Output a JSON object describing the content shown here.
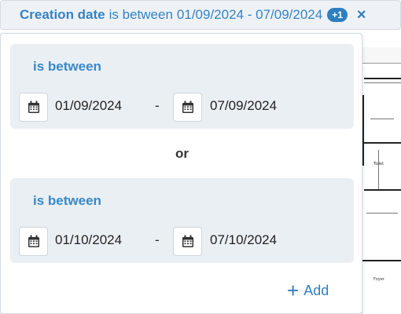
{
  "chip": {
    "field": "Creation date",
    "operator": "is between",
    "range": "01/09/2024 - 07/09/2024",
    "extra_count": "+1",
    "close_icon": "×"
  },
  "groups": [
    {
      "operator_label": "is between",
      "start_date": "01/09/2024",
      "separator": "-",
      "end_date": "07/09/2024"
    },
    {
      "operator_label": "is between",
      "start_date": "01/10/2024",
      "separator": "-",
      "end_date": "07/10/2024"
    }
  ],
  "or_label": "or",
  "add": {
    "icon": "+",
    "label": "Add"
  },
  "background_plan": {
    "label_toilet": "Toilet",
    "label_foyer": "Foyer"
  },
  "colors": {
    "accent": "#2f7fc0",
    "group_bg": "#eaeff4",
    "chip_bg": "#eef2f7"
  }
}
